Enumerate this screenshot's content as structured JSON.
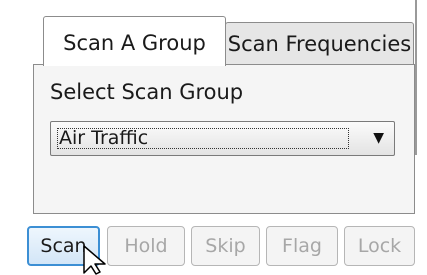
{
  "tabs": [
    {
      "label": "Scan A Group",
      "active": true
    },
    {
      "label": "Scan Frequencies",
      "active": false
    }
  ],
  "panel": {
    "select_label": "Select Scan Group",
    "selected_group": "Air Traffic"
  },
  "buttons": {
    "scan": "Scan",
    "hold": "Hold",
    "skip": "Skip",
    "flag": "Flag",
    "lock": "Lock"
  },
  "icons": {
    "dropdown": "chevron-down-icon",
    "cursor": "mouse-pointer-icon"
  },
  "colors": {
    "focus_border": "#3c8fd4",
    "disabled_text": "#a7a7a7"
  }
}
